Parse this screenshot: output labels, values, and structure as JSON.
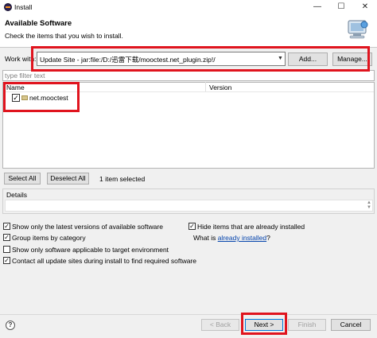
{
  "window": {
    "title": "Install"
  },
  "header": {
    "title": "Available Software",
    "subtitle": "Check the items that you wish to install."
  },
  "work_with": {
    "label": "Work with:",
    "value": "Update Site - jar:file:/D:/迅雷下载/mooctest.net_plugin.zip!/",
    "add_label": "Add...",
    "manage_label": "Manage..."
  },
  "filter": {
    "placeholder": "type filter text"
  },
  "tree": {
    "columns": [
      "Name",
      "Version"
    ],
    "rows": [
      {
        "name": "net.mooctest",
        "version": "",
        "checked": true
      }
    ]
  },
  "selection": {
    "select_all": "Select All",
    "deselect_all": "Deselect All",
    "status": "1 item selected"
  },
  "details": {
    "label": "Details"
  },
  "options": [
    {
      "label": "Show only the latest versions of available software",
      "checked": true
    },
    {
      "label": "Group items by category",
      "checked": true
    },
    {
      "label": "Show only software applicable to target environment",
      "checked": false
    },
    {
      "label": "Contact all update sites during install to find required software",
      "checked": true
    },
    {
      "label": "Hide items that are already installed",
      "checked": true
    }
  ],
  "what_is": {
    "prefix": "What is ",
    "link": "already installed",
    "suffix": "?"
  },
  "footer": {
    "back": "< Back",
    "next": "Next >",
    "finish": "Finish",
    "cancel": "Cancel"
  },
  "annotation_color": "#e0141e"
}
